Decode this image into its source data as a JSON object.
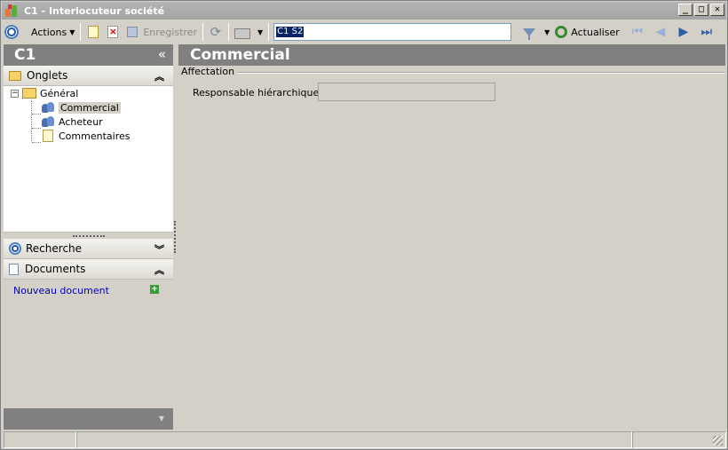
{
  "window": {
    "title": "C1 -  Interlocuteur société",
    "buttons": [
      "_",
      "□",
      "✕"
    ]
  },
  "toolbar": {
    "actions_label": "Actions",
    "save_label": "Enregistrer",
    "search_value": "C1 S2",
    "refresh_label": "Actualiser"
  },
  "left_panel": {
    "title": "C1",
    "collapse_glyph": "«",
    "sections": {
      "onglets": "Onglets",
      "recherche": "Recherche",
      "documents": "Documents"
    },
    "tree": {
      "root": "Général",
      "children": [
        "Commercial",
        "Acheteur",
        "Commentaires"
      ],
      "selected": "Commercial"
    },
    "new_document_link": "Nouveau document"
  },
  "main": {
    "title": "Commercial",
    "group_title": "Affectation",
    "field_label": "Responsable hiérarchique :",
    "field_value": ""
  }
}
